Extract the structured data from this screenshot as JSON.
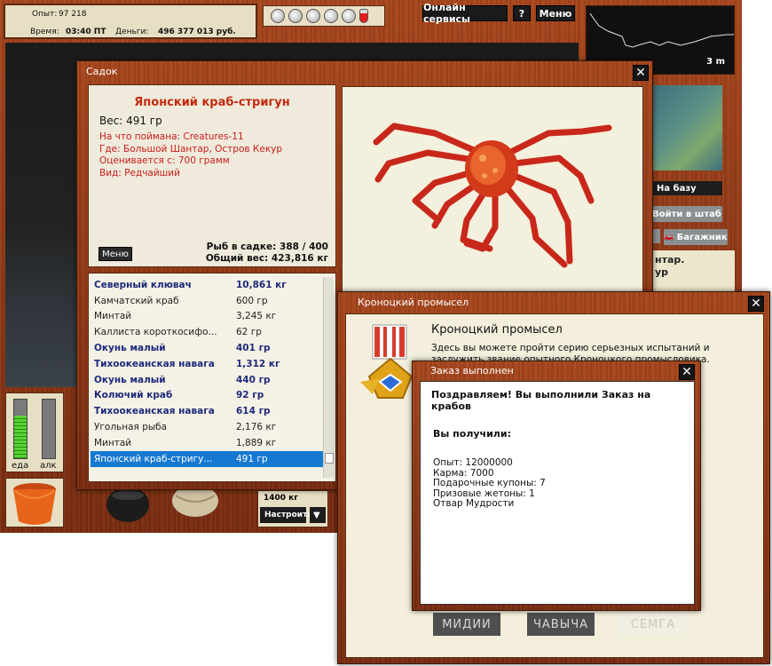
{
  "hud": {
    "exp_label": "Опыт:",
    "exp_value": "97 218",
    "time_label": "Время:",
    "time_value": "03:40 ПТ",
    "money_label": "Деньги:",
    "money_value": "496 377 013 руб.",
    "online_services": "Онлайн сервисы",
    "help": "?",
    "menu": "Меню",
    "depth": "3 m",
    "to_base": "На базу",
    "to_hq": "Войти в штаб",
    "trunk": "Багажник",
    "location_partial_1": "нтар.",
    "location_partial_2": "ур",
    "meter_food": "еда",
    "meter_alc": "алк",
    "food_level": 0.72,
    "alc_level": 0.0,
    "setup_weight": "1400 кг",
    "setup_button": "Настроить"
  },
  "sadok": {
    "title": "Садок",
    "close": "✕",
    "fish_name": "Японский краб-стригун",
    "weight": "Вес: 491 гр",
    "caught_on": "На что поймана: Creatures-11",
    "where": "Где: Большой Шантар, Остров Кекур",
    "valued_from": "Оценивается с: 700 грамм",
    "kind": "Вид: Редчайший",
    "menu_button": "Меню",
    "fish_count": "Рыб в садке: 388 / 400",
    "total_weight": "Общий вес: 423,816 кг",
    "list": [
      {
        "name": "Северный клювач",
        "weight": "10,861 кг",
        "style": "bold"
      },
      {
        "name": "Камчатский краб",
        "weight": "600 гр",
        "style": "normal"
      },
      {
        "name": "Минтай",
        "weight": "3,245 кг",
        "style": "normal"
      },
      {
        "name": "Каллиста короткосифо...",
        "weight": "62 гр",
        "style": "normal"
      },
      {
        "name": "Окунь малый",
        "weight": "401 гр",
        "style": "bold"
      },
      {
        "name": "Тихоокеанская навага",
        "weight": "1,312 кг",
        "style": "bold"
      },
      {
        "name": "Окунь малый",
        "weight": "440 гр",
        "style": "bold"
      },
      {
        "name": "Колючий краб",
        "weight": "92 гр",
        "style": "bold"
      },
      {
        "name": "Тихоокеанская навага",
        "weight": "614 гр",
        "style": "bold"
      },
      {
        "name": "Угольная рыба",
        "weight": "2,176 кг",
        "style": "normal"
      },
      {
        "name": "Минтай",
        "weight": "1,889 кг",
        "style": "normal"
      },
      {
        "name": "Японский краб-стригу...",
        "weight": "491 гр",
        "style": "sel"
      }
    ]
  },
  "kron": {
    "window_title": "Кроноцкий промысел",
    "close": "✕",
    "heading": "Кроноцкий промысел",
    "description": "Здесь вы можете пройти серию серьезных испытаний и заслужить звание опытного Кроноцкого промысловика.",
    "btn_mussels": "МИДИИ",
    "btn_chavycha": "ЧАВЫЧА",
    "btn_semga": "СЕМГА"
  },
  "order": {
    "window_title": "Заказ выполнен",
    "close": "✕",
    "congrats": "Поздравляем! Вы выполнили Заказ на крабов",
    "received": "Вы получили:",
    "rewards": [
      "Опыт: 12000000",
      "Карма: 7000",
      "Подарочные купоны: 7",
      "Призовые жетоны: 1",
      "Отвар Мудрости"
    ]
  },
  "colors": {
    "wood": "#8e3818",
    "fish_name": "#c22a0e",
    "details_red": "#c81d1d",
    "list_bold": "#1e2a7a",
    "selection": "#1679d1"
  }
}
